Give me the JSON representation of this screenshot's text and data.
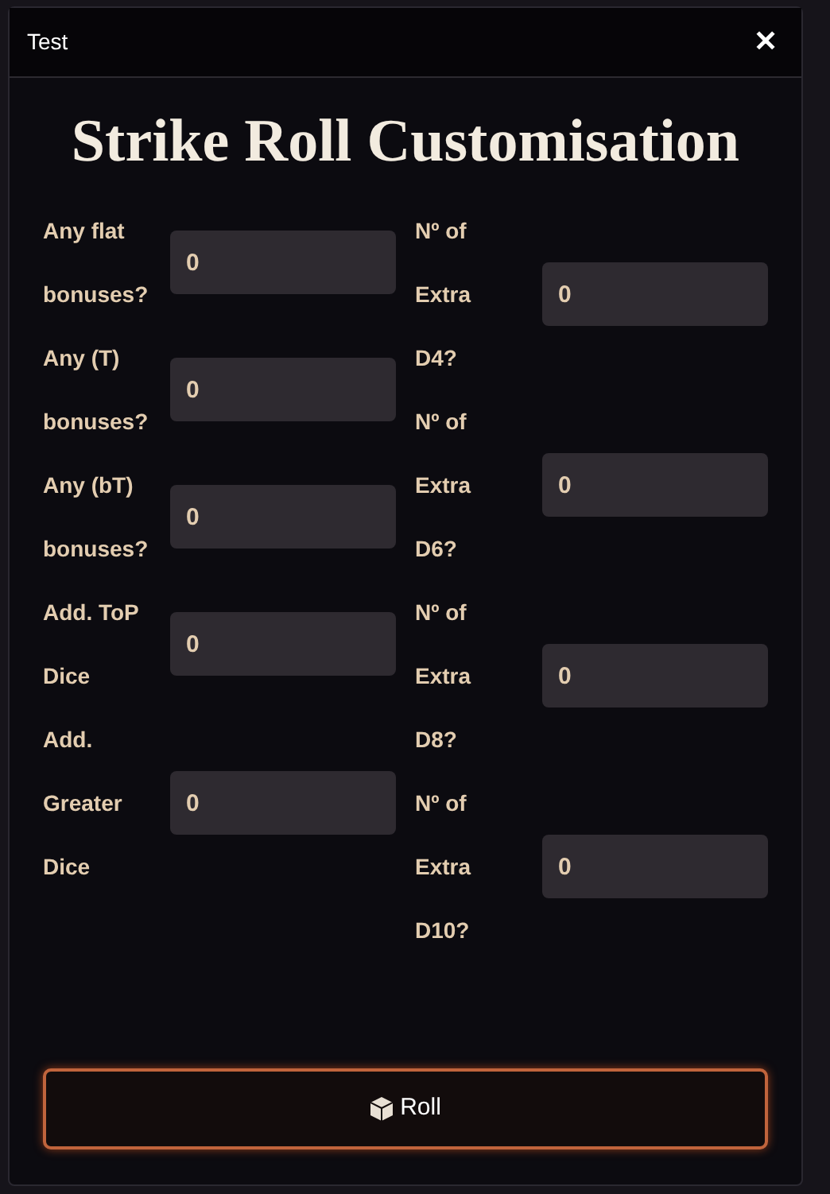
{
  "window": {
    "title": "Test",
    "close": "✕"
  },
  "heading": "Strike Roll Customisation",
  "left_fields": [
    {
      "label": "Any flat bonuses?",
      "value": "0"
    },
    {
      "label": "Any (T) bonuses?",
      "value": "0"
    },
    {
      "label": "Any (bT) bonuses?",
      "value": "0"
    },
    {
      "label": "Add. ToP Dice",
      "value": "0"
    },
    {
      "label": "Add. Greater Dice",
      "value": "0"
    }
  ],
  "right_fields": [
    {
      "label": "Nº of Extra D4?",
      "value": "0"
    },
    {
      "label": "Nº of Extra D6?",
      "value": "0"
    },
    {
      "label": "Nº of Extra D8?",
      "value": "0"
    },
    {
      "label": "Nº of Extra D10?",
      "value": "0"
    }
  ],
  "button": {
    "label": "Roll"
  }
}
